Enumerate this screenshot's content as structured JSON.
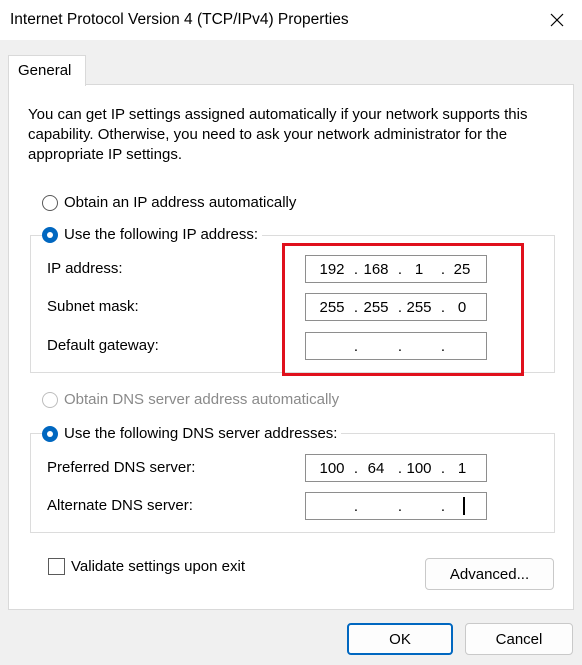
{
  "window": {
    "title": "Internet Protocol Version 4 (TCP/IPv4) Properties",
    "close_icon": "close-icon"
  },
  "tabs": [
    {
      "label": "General",
      "selected": true
    }
  ],
  "general": {
    "description": "You can get IP settings assigned automatically if your network supports this capability. Otherwise, you need to ask your network administrator for the appropriate IP settings.",
    "ip_mode": {
      "auto_label": "Obtain an IP address automatically",
      "manual_label": "Use the following IP address:",
      "selected": "manual"
    },
    "ip_fields": {
      "ip_address": {
        "label": "IP address:",
        "octets": [
          "192",
          "168",
          "1",
          "25"
        ]
      },
      "subnet_mask": {
        "label": "Subnet mask:",
        "octets": [
          "255",
          "255",
          "255",
          "0"
        ]
      },
      "default_gateway": {
        "label": "Default gateway:",
        "octets": [
          "",
          "",
          "",
          ""
        ]
      }
    },
    "dns_mode": {
      "auto_label": "Obtain DNS server address automatically",
      "manual_label": "Use the following DNS server addresses:",
      "selected": "manual",
      "auto_disabled": true
    },
    "dns_fields": {
      "preferred": {
        "label": "Preferred DNS server:",
        "octets": [
          "100",
          "64",
          "100",
          "1"
        ]
      },
      "alternate": {
        "label": "Alternate DNS server:",
        "octets": [
          "",
          "",
          "",
          ""
        ]
      }
    },
    "validate_label": "Validate settings upon exit",
    "validate_checked": false,
    "advanced_label": "Advanced..."
  },
  "footer": {
    "ok_label": "OK",
    "cancel_label": "Cancel"
  },
  "colors": {
    "accent": "#0067c0",
    "highlight_border": "#e0101c"
  }
}
